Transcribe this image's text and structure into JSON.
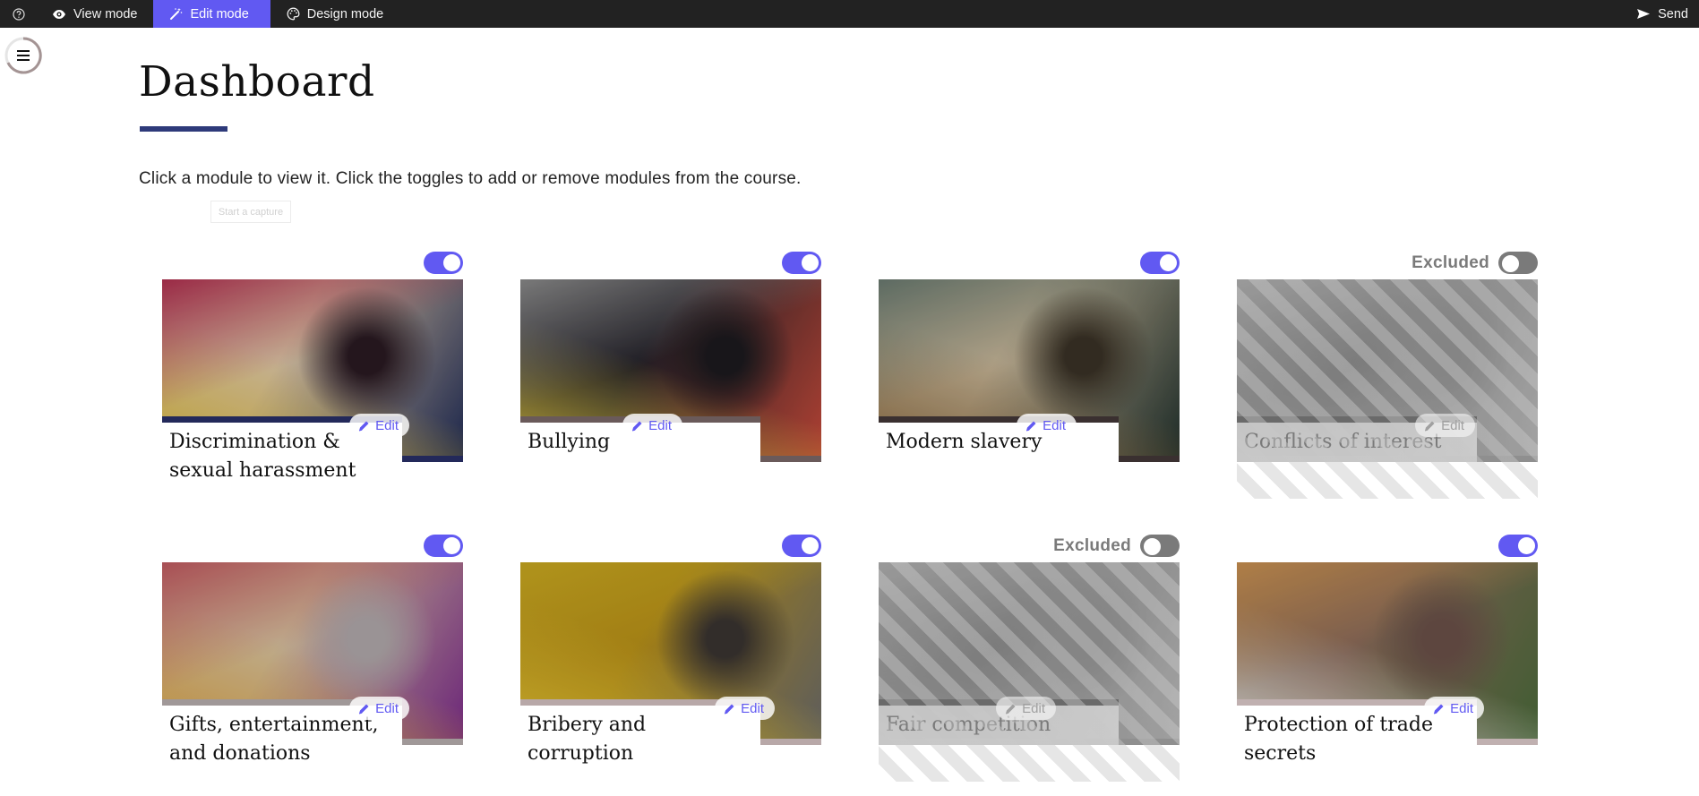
{
  "topbar": {
    "help_icon": "question-circle-icon",
    "items": [
      {
        "label": "View mode",
        "icon": "eye-icon",
        "active": false
      },
      {
        "label": "Edit mode",
        "icon": "magic-wand-icon",
        "active": true
      },
      {
        "label": "Design mode",
        "icon": "palette-icon",
        "active": false
      }
    ],
    "send": {
      "label": "Send",
      "icon": "send-icon"
    }
  },
  "menu": {
    "icon": "hamburger-icon"
  },
  "header": {
    "title": "Dashboard",
    "intro": "Click a module to view it. Click the toggles to add or remove modules from the course.",
    "capture_button": "Start a capture"
  },
  "colors": {
    "accent": "#6159f2",
    "title_rule": "#2e3a7a",
    "topbar": "#222222",
    "excluded_gray": "#7a7a7a"
  },
  "modules": [
    {
      "title": "Discrimination & sexual harassment",
      "included": true,
      "status_label": "",
      "edit_label": "Edit",
      "image": "colored-pencils",
      "bar_color": "#23295a",
      "img_colors": [
        "#2a1a22",
        "#b03050",
        "#d8b83a",
        "#1e2a55",
        "#e0c9a8"
      ]
    },
    {
      "title": "Bullying",
      "included": true,
      "status_label": "",
      "edit_label": "Edit",
      "image": "darts-on-board",
      "bar_color": "#6a5a5a",
      "img_colors": [
        "#1c1a1e",
        "#8a8a8a",
        "#d8c040",
        "#c84a3a",
        "#222028"
      ]
    },
    {
      "title": "Modern slavery",
      "included": true,
      "status_label": "",
      "edit_label": "Edit",
      "image": "factory-hall",
      "bar_color": "#3a3030",
      "img_colors": [
        "#3a3226",
        "#6a7a70",
        "#8a6a40",
        "#20302c",
        "#c9b89a"
      ]
    },
    {
      "title": "Conflicts of interest",
      "included": false,
      "status_label": "Excluded",
      "edit_label": "Edit",
      "image": "snake-head",
      "bar_color": "#6a6a6a",
      "img_colors": [
        "#6a6a6a",
        "#8a8a8a",
        "#7a7a7a",
        "#9a9a9a",
        "#5a5a5a"
      ]
    },
    {
      "title": "Gifts, entertainment, and donations",
      "included": true,
      "status_label": "",
      "edit_label": "Edit",
      "image": "macarons-gift-box",
      "bar_color": "#a09898",
      "img_colors": [
        "#b0a8aa",
        "#c05a60",
        "#d8a040",
        "#7a2a8a",
        "#d9c4a0"
      ]
    },
    {
      "title": "Bribery and corruption",
      "included": true,
      "status_label": "",
      "edit_label": "Edit",
      "image": "yellow-sports-car",
      "bar_color": "#b8a8a8",
      "img_colors": [
        "#3a3430",
        "#c8a820",
        "#e0c030",
        "#6a6a6a",
        "#b89018"
      ]
    },
    {
      "title": "Fair competition",
      "included": false,
      "status_label": "Excluded",
      "edit_label": "Edit",
      "image": "horse-race",
      "bar_color": "#6a6a6a",
      "img_colors": [
        "#6a6a6a",
        "#8a8a8a",
        "#7a7a7a",
        "#9a9a9a",
        "#5a5a5a"
      ]
    },
    {
      "title": "Protection of trade secrets",
      "included": true,
      "status_label": "",
      "edit_label": "Edit",
      "image": "restaurant-table",
      "bar_color": "#c0b0b0",
      "img_colors": [
        "#6a5048",
        "#c89050",
        "#e0e0d8",
        "#4a6a3a",
        "#8a6a5a"
      ]
    }
  ]
}
